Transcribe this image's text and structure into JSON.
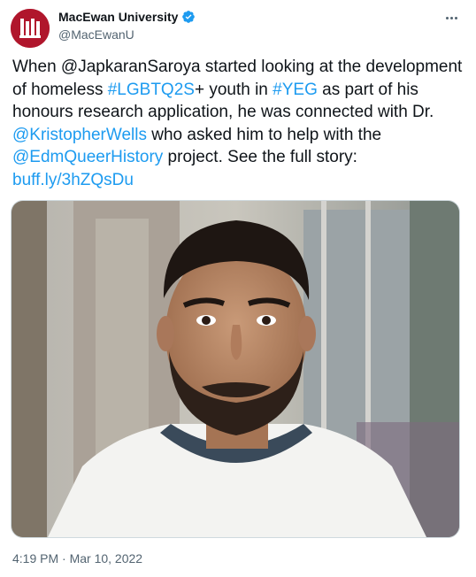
{
  "account": {
    "name": "MacEwan University",
    "handle": "@MacEwanU",
    "brand_color": "#b0162c",
    "verified": true,
    "avatar_icon": "macewan-logo"
  },
  "tweet": {
    "segments": [
      {
        "text": "When ",
        "type": "text"
      },
      {
        "text": "@JapkaranSaroya",
        "type": "text"
      },
      {
        "text": " started looking at the development of homeless ",
        "type": "text"
      },
      {
        "text": "#LGBTQ2S",
        "type": "link"
      },
      {
        "text": "+ youth in ",
        "type": "text"
      },
      {
        "text": "#YEG",
        "type": "link"
      },
      {
        "text": " as part of his honours research application, he was connected with Dr. ",
        "type": "text"
      },
      {
        "text": "@KristopherWells",
        "type": "link"
      },
      {
        "text": " who asked him to help with the ",
        "type": "text"
      },
      {
        "text": "@EdmQueerHistory",
        "type": "link"
      },
      {
        "text": " project. See the full story: ",
        "type": "text"
      },
      {
        "text": "buff.ly/3hZQsDu",
        "type": "link"
      }
    ],
    "timestamp": "4:19 PM · Mar 10, 2022",
    "link_color": "#1d9bf0"
  },
  "icons": {
    "more": "more-icon",
    "verified": "verified-badge-icon"
  }
}
